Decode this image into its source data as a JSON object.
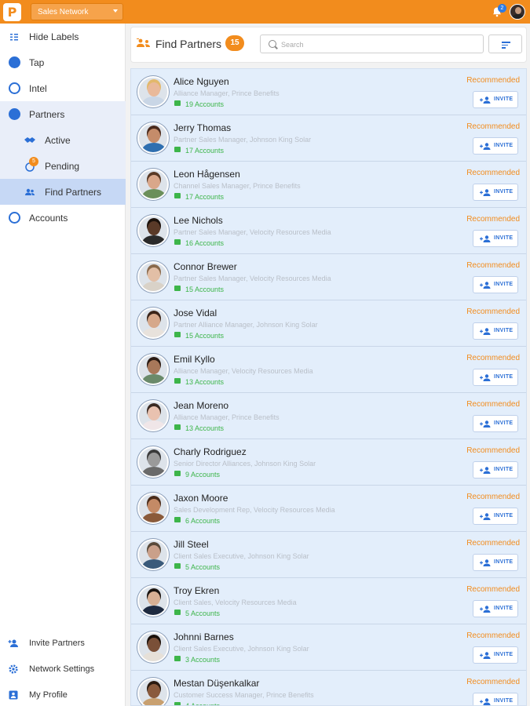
{
  "topbar": {
    "logo_letter": "P",
    "network_select": "Sales Network",
    "notification_count": "2",
    "brand_color": "#f28c1d"
  },
  "sidebar": {
    "items": [
      {
        "label": "Hide Labels",
        "icon": "collapse-icon"
      },
      {
        "label": "Tap",
        "icon": "tap-icon"
      },
      {
        "label": "Intel",
        "icon": "intel-icon"
      },
      {
        "label": "Partners",
        "icon": "partners-icon"
      },
      {
        "label": "Active",
        "icon": "handshake-icon"
      },
      {
        "label": "Pending",
        "icon": "pending-icon",
        "badge": "5"
      },
      {
        "label": "Find Partners",
        "icon": "find-partners-icon"
      },
      {
        "label": "Accounts",
        "icon": "accounts-icon"
      }
    ],
    "footer": [
      {
        "label": "Invite Partners",
        "icon": "add-user-icon"
      },
      {
        "label": "Network Settings",
        "icon": "gear-icon"
      },
      {
        "label": "My Profile",
        "icon": "profile-icon"
      }
    ]
  },
  "header": {
    "title": "Find Partners",
    "count": "15",
    "search_placeholder": "Search"
  },
  "partners": [
    {
      "name": "Alice Nguyen",
      "role": "Alliance Manager, Prince Benefits",
      "accounts": "19 Accounts",
      "tag": "Recommended",
      "invite": "INVITE",
      "skin": "#e9b99a",
      "hair": "#e2b86b",
      "shirt": "#c9d6e6"
    },
    {
      "name": "Jerry Thomas",
      "role": "Partner Sales Manager, Johnson King Solar",
      "accounts": "17 Accounts",
      "tag": "Recommended",
      "invite": "INVITE",
      "skin": "#c58c6a",
      "hair": "#4a2a1c",
      "shirt": "#2f6fb0"
    },
    {
      "name": "Leon Hågensen",
      "role": "Channel Sales Manager, Prince Benefits",
      "accounts": "17 Accounts",
      "tag": "Recommended",
      "invite": "INVITE",
      "skin": "#d9a78a",
      "hair": "#5a3a26",
      "shirt": "#6b8f5a"
    },
    {
      "name": "Lee Nichols",
      "role": "Partner Sales Manager, Velocity Resources Media",
      "accounts": "16 Accounts",
      "tag": "Recommended",
      "invite": "INVITE",
      "skin": "#5a3a28",
      "hair": "#1c120c",
      "shirt": "#2a2a2a"
    },
    {
      "name": "Connor Brewer",
      "role": "Partner Sales Manager, Velocity Resources Media",
      "accounts": "15 Accounts",
      "tag": "Recommended",
      "invite": "INVITE",
      "skin": "#e2bfa6",
      "hair": "#8a6a4c",
      "shirt": "#d9d2c8"
    },
    {
      "name": "Jose Vidal",
      "role": "Partner Alliance Manager, Johnson King Solar",
      "accounts": "15 Accounts",
      "tag": "Recommended",
      "invite": "INVITE",
      "skin": "#d6a88a",
      "hair": "#3a2418",
      "shirt": "#e8e2dc"
    },
    {
      "name": "Emil Kyllo",
      "role": "Alliance Manager, Velocity Resources Media",
      "accounts": "13 Accounts",
      "tag": "Recommended",
      "invite": "INVITE",
      "skin": "#a8785a",
      "hair": "#2a1a12",
      "shirt": "#6a8a6a"
    },
    {
      "name": "Jean Moreno",
      "role": "Alliance Manager, Prince Benefits",
      "accounts": "13 Accounts",
      "tag": "Recommended",
      "invite": "INVITE",
      "skin": "#e9c2b0",
      "hair": "#3a2a22",
      "shirt": "#f0e6e8"
    },
    {
      "name": "Charly Rodriguez",
      "role": "Senior Director Alliances, Johnson King Solar",
      "accounts": "9 Accounts",
      "tag": "Recommended",
      "invite": "INVITE",
      "skin": "#9a9a9a",
      "hair": "#3a3a3a",
      "shirt": "#6a6a6a"
    },
    {
      "name": "Jaxon Moore",
      "role": "Sales Development Rep, Velocity Resources Media",
      "accounts": "6 Accounts",
      "tag": "Recommended",
      "invite": "INVITE",
      "skin": "#c48a66",
      "hair": "#4a2c1a",
      "shirt": "#8a5a3a"
    },
    {
      "name": "Jill Steel",
      "role": "Client Sales Executive, Johnson King Solar",
      "accounts": "5 Accounts",
      "tag": "Recommended",
      "invite": "INVITE",
      "skin": "#caa08a",
      "hair": "#5a4a3a",
      "shirt": "#3a5a7a"
    },
    {
      "name": "Troy Ekren",
      "role": "Client Sales, Velocity Resources Media",
      "accounts": "5 Accounts",
      "tag": "Recommended",
      "invite": "INVITE",
      "skin": "#d8b094",
      "hair": "#1a1410",
      "shirt": "#1e2a40"
    },
    {
      "name": "Johnni Barnes",
      "role": "Client Sales Executive, Johnson King Solar",
      "accounts": "3 Accounts",
      "tag": "Recommended",
      "invite": "INVITE",
      "skin": "#7a5038",
      "hair": "#1a100a",
      "shirt": "#e6e0d8"
    },
    {
      "name": "Mestan Düşenkalkar",
      "role": "Customer Success Manager, Prince Benefits",
      "accounts": "4 Accounts",
      "tag": "Recommended",
      "invite": "INVITE",
      "skin": "#8a5a3c",
      "hair": "#2a1a10",
      "shirt": "#c8a070"
    }
  ]
}
